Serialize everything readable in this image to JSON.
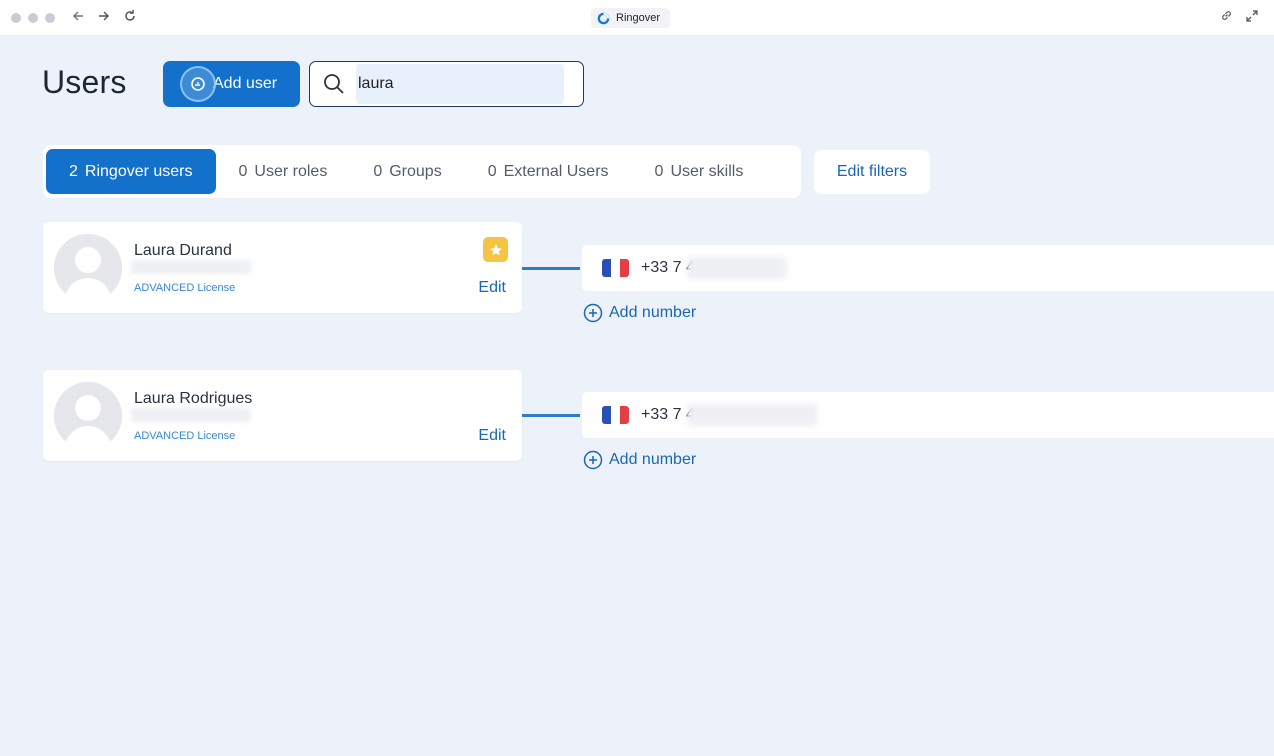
{
  "browser": {
    "tab_title": "Ringover",
    "back_icon": "arrow-left-icon",
    "forward_icon": "arrow-right-icon",
    "reload_icon": "reload-icon"
  },
  "page": {
    "title": "Users",
    "add_user_label": "Add user",
    "search_value": "laura",
    "edit_filters_label": "Edit filters"
  },
  "tabs": [
    {
      "count": "2",
      "label": "Ringover users",
      "active": true
    },
    {
      "count": "0",
      "label": "User roles",
      "active": false
    },
    {
      "count": "0",
      "label": "Groups",
      "active": false
    },
    {
      "count": "0",
      "label": "External Users",
      "active": false
    },
    {
      "count": "0",
      "label": "User skills",
      "active": false
    }
  ],
  "users": [
    {
      "name": "Laura Durand",
      "license": "ADVANCED License",
      "edit_label": "Edit",
      "starred": true,
      "phone": "+33 7 4",
      "add_number_label": "Add number"
    },
    {
      "name": "Laura Rodrigues",
      "license": "ADVANCED License",
      "edit_label": "Edit",
      "starred": false,
      "phone": "+33 7 4",
      "add_number_label": "Add number"
    }
  ],
  "colors": {
    "accent": "#1371cc",
    "link": "#1a66b5",
    "background": "#edf2fa",
    "star": "#f6c443",
    "flag_blue": "#2a4fb5",
    "flag_white": "#ffffff",
    "flag_red": "#e43f44"
  }
}
